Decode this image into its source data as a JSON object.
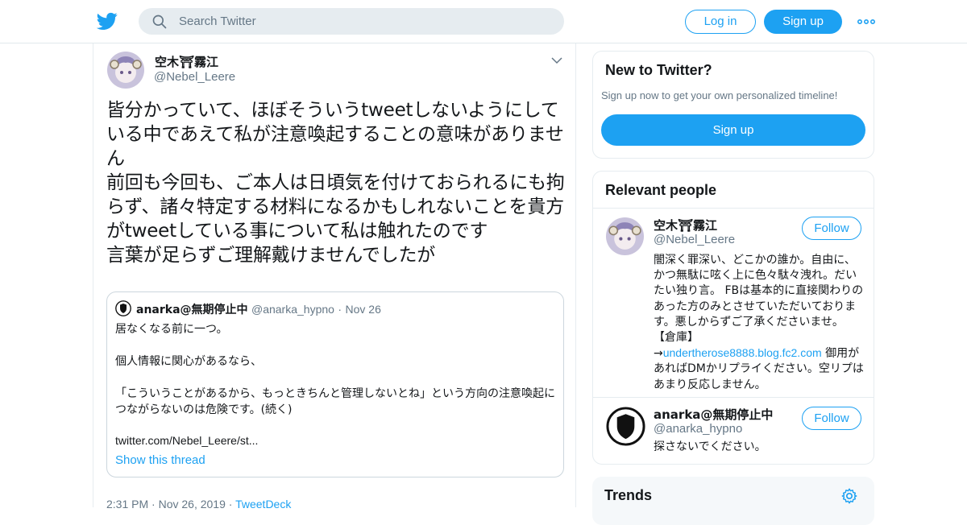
{
  "header": {
    "search_placeholder": "Search Twitter",
    "login_label": "Log in",
    "signup_label": "Sign up",
    "brand_color": "#1da1f2"
  },
  "tweet": {
    "display_name": "空木⛩霧江",
    "handle": "@Nebel_Leere",
    "text": "皆分かっていて、ほぼそういうtweetしないようにしている中であえて私が注意喚起することの意味がありません\n前回も今回も、ご本人は日頃気を付けておられるにも拘らず、諸々特定する材料になるかもしれないことを貴方がtweetしている事について私は触れたのです\n言葉が足らずご理解戴けませんでしたが",
    "quoted": {
      "display_name": "anarka@無期停止中",
      "handle": "@anarka_hypno",
      "separator": "·",
      "date": "Nov 26",
      "body": "居なくなる前に一つ。\n\n個人情報に関心があるなら、\n\n「こういうことがあるから、もっときちんと管理しないとね」という方向の注意喚起につながらないのは危険です。(続く)",
      "link": "twitter.com/Nebel_Leere/st...",
      "show_thread": "Show this thread"
    },
    "time": "2:31 PM",
    "date": "Nov 26, 2019",
    "dot": "·",
    "source": "TweetDeck"
  },
  "sidebar": {
    "new_to_twitter": {
      "title": "New to Twitter?",
      "subtitle": "Sign up now to get your own personalized timeline!",
      "button": "Sign up"
    },
    "relevant_people": {
      "title": "Relevant people",
      "people": [
        {
          "display_name": "空木⛩霧江",
          "handle": "@Nebel_Leere",
          "follow": "Follow",
          "bio_before_link": "闇深く罪深い、どこかの誰か。自由に、かつ無駄に呟く上に色々駄々洩れ。だいたい独り言。 FBは基本的に直接関わりのあった方のみとさせていただいております。悪しからずご了承くださいませ。 【倉庫】→",
          "bio_link": "undertherose8888.blog.fc2.com",
          "bio_after_link": " 御用があればDMかリプライください。空リプはあまり反応しません。"
        },
        {
          "display_name": "anarka@無期停止中",
          "handle": "@anarka_hypno",
          "follow": "Follow",
          "bio": "探さないでください。"
        }
      ]
    },
    "trends": {
      "title": "Trends"
    }
  }
}
